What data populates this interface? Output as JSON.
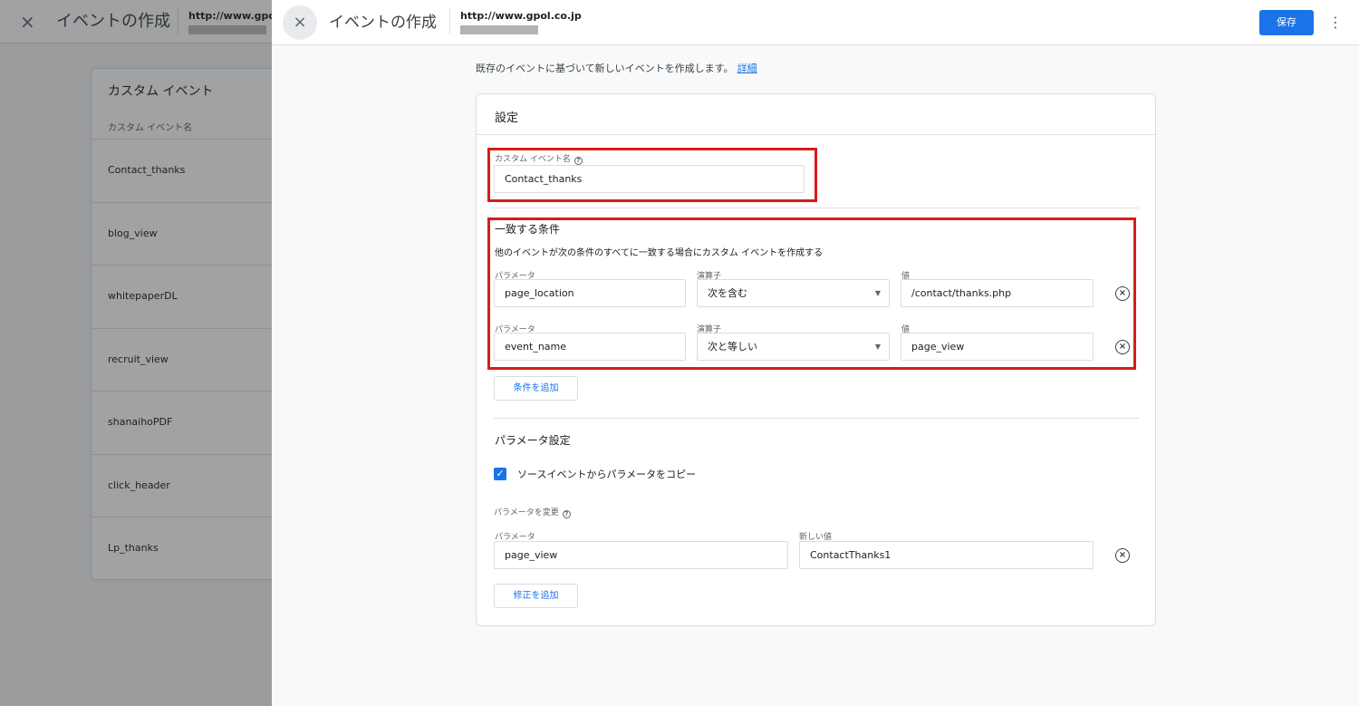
{
  "background": {
    "title": "イベントの作成",
    "url": "http://www.gpol.co",
    "card_title": "カスタム イベント",
    "column_header": "カスタム イベント名",
    "events": [
      "Contact_thanks",
      "blog_view",
      "whitepaperDL",
      "recruit_view",
      "shanaihoPDF",
      "click_header",
      "Lp_thanks"
    ]
  },
  "header": {
    "close_icon": "×",
    "title": "イベントの作成",
    "url": "http://www.gpol.co.jp",
    "save_label": "保存",
    "more_icon": "⋮"
  },
  "intro": {
    "text": "既存のイベントに基づいて新しいイベントを作成します。",
    "link": "詳細"
  },
  "settings": {
    "title": "設定",
    "custom_event_label": "カスタム イベント名",
    "custom_event_value": "Contact_thanks",
    "help_icon": "?",
    "match": {
      "title": "一致する条件",
      "description": "他のイベントが次の条件のすべてに一致する場合にカスタム イベントを作成する",
      "param_label": "パラメータ",
      "operator_label": "演算子",
      "value_label": "値",
      "rows": [
        {
          "param": "page_location",
          "operator": "次を含む",
          "value": "/contact/thanks.php"
        },
        {
          "param": "event_name",
          "operator": "次と等しい",
          "value": "page_view"
        }
      ],
      "add_condition": "条件を追加"
    },
    "params": {
      "title": "パラメータ設定",
      "copy_label": "ソースイベントからパラメータをコピー",
      "copy_checked": true,
      "modify_label": "パラメータを変更",
      "param_label": "パラメータ",
      "new_value_label": "新しい値",
      "param_value": "page_view",
      "new_value": "ContactThanks1",
      "add_modification": "修正を追加"
    }
  },
  "icons": {
    "remove": "×",
    "dropdown": "▼",
    "check": "✓"
  }
}
